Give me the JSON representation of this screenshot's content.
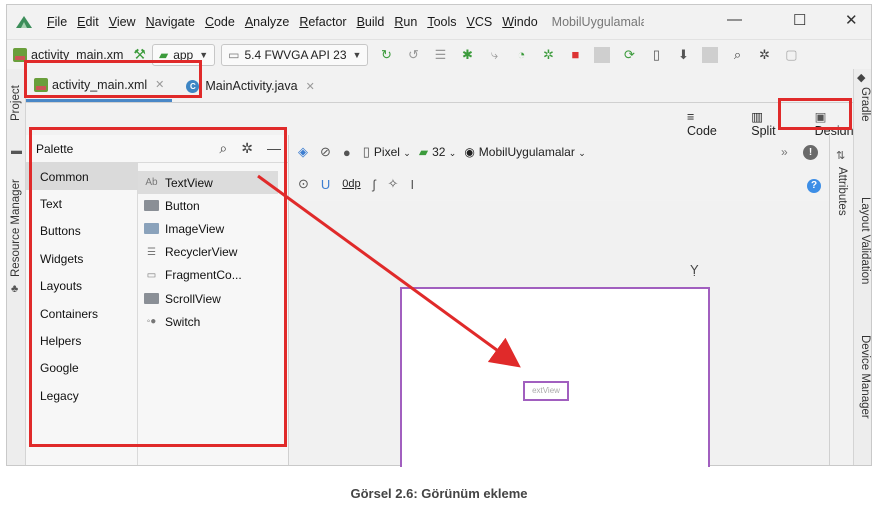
{
  "menubar": {
    "items": [
      "File",
      "Edit",
      "View",
      "Navigate",
      "Code",
      "Analyze",
      "Refactor",
      "Build",
      "Run",
      "Tools",
      "VCS",
      "Windo"
    ],
    "title": "MobilUygulamala",
    "minimize": "—",
    "maximize": "☐",
    "close": "✕"
  },
  "toolbar": {
    "file": "activity_main.xm",
    "module": "app",
    "device": "5.4  FWVGA API 23"
  },
  "left_strip": {
    "project": "Project",
    "resource_manager": "Resource Manager"
  },
  "right_strip": {
    "gradle": "Gradle",
    "layout_validation": "Layout Validation",
    "device_manager": "Device Manager"
  },
  "tabs": [
    {
      "label": "activity_main.xml"
    },
    {
      "label": "MainActivity.java"
    }
  ],
  "view_modes": {
    "code": "Code",
    "split": "Split",
    "design": "Design"
  },
  "palette": {
    "title": "Palette",
    "categories": [
      "Common",
      "Text",
      "Buttons",
      "Widgets",
      "Layouts",
      "Containers",
      "Helpers",
      "Google",
      "Legacy"
    ],
    "selected_category": "Common",
    "items": [
      {
        "label": "TextView",
        "icon": "Ab"
      },
      {
        "label": "Button",
        "icon": ""
      },
      {
        "label": "ImageView",
        "icon": ""
      },
      {
        "label": "RecyclerView",
        "icon": "☰"
      },
      {
        "label": "FragmentCo...",
        "icon": "▭"
      },
      {
        "label": "ScrollView",
        "icon": ""
      },
      {
        "label": "Switch",
        "icon": "◦●"
      }
    ]
  },
  "design_toolbar": {
    "device": "Pixel",
    "api": "32",
    "theme": "MobilUygulamalar",
    "margin": "0dp"
  },
  "attributes_label": "Attributes",
  "canvas": {
    "textview_label": "extView"
  },
  "caption": "Görsel 2.6: Görünüm ekleme",
  "colors": {
    "highlight": "#e02a2a",
    "blueprint_border": "#a15fbf",
    "accent": "#4a88c7"
  }
}
